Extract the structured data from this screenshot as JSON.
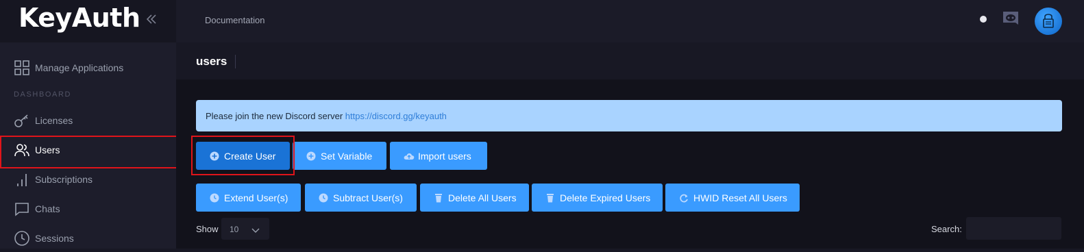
{
  "app": {
    "logo": "KeyAuth"
  },
  "topbar": {
    "documentation": "Documentation"
  },
  "sidebar": {
    "manage_apps": "Manage Applications",
    "section": "DASHBOARD",
    "items": [
      {
        "label": "Licenses",
        "icon": "key-icon"
      },
      {
        "label": "Users",
        "icon": "users-icon",
        "active": true
      },
      {
        "label": "Subscriptions",
        "icon": "bar-chart-icon"
      },
      {
        "label": "Chats",
        "icon": "chat-icon"
      },
      {
        "label": "Sessions",
        "icon": "clock-icon"
      }
    ]
  },
  "page": {
    "title": "users"
  },
  "alert": {
    "text": "Please join the new Discord server ",
    "link": "https://discord.gg/keyauth"
  },
  "actions": {
    "row1": [
      "Create User",
      "Set Variable",
      "Import users"
    ],
    "row2": [
      "Extend User(s)",
      "Subtract User(s)",
      "Delete All Users",
      "Delete Expired Users",
      "HWID Reset All Users"
    ]
  },
  "table_controls": {
    "show_label": "Show",
    "page_size": "10",
    "search_label": "Search:",
    "search_value": ""
  },
  "colors": {
    "accent": "#3a9bff",
    "primary": "#1a73d6",
    "alert_bg": "#a9d3ff",
    "highlight": "#e0141a"
  }
}
